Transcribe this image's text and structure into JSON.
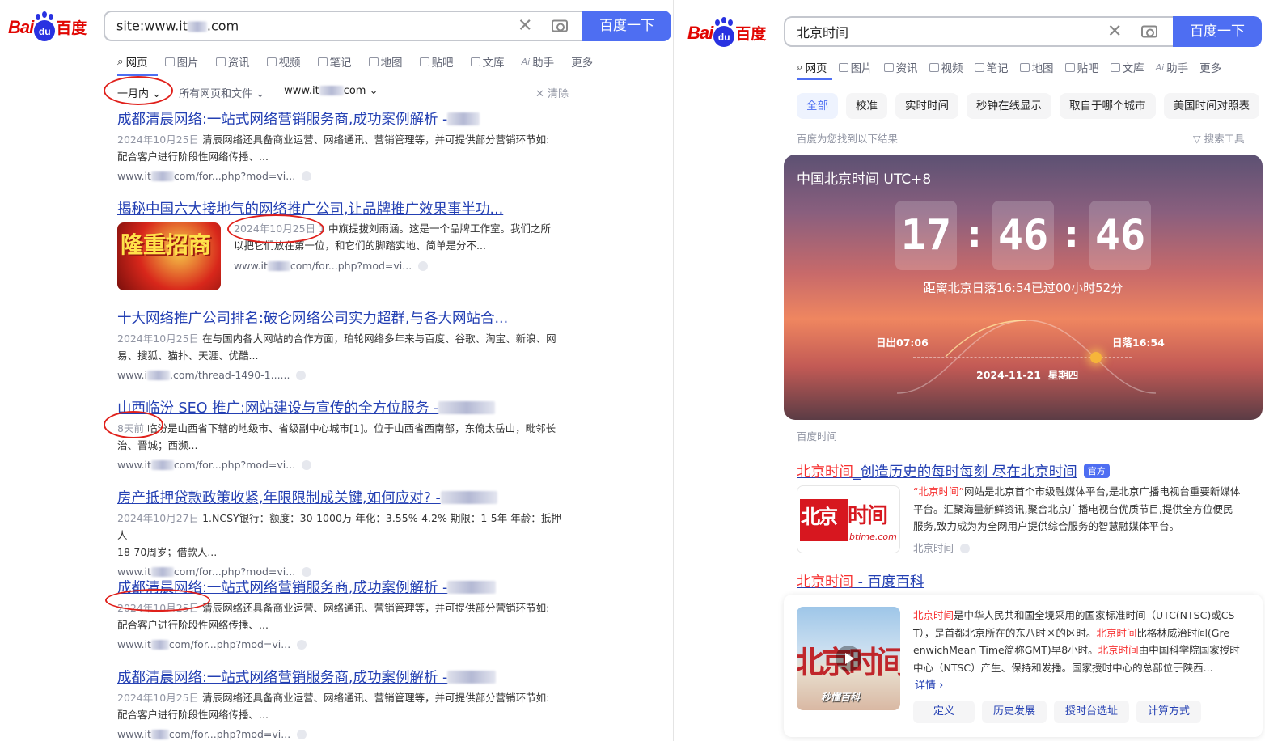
{
  "left": {
    "logo": {
      "bai": "Bai",
      "du": "du",
      "cn": "百度"
    },
    "search": {
      "query_pre": "site:www.it",
      "query_post": ".com",
      "button": "百度一下"
    },
    "tabs": [
      "网页",
      "图片",
      "资讯",
      "视频",
      "笔记",
      "地图",
      "贴吧",
      "文库",
      "助手",
      "更多"
    ],
    "filters": {
      "time": "一月内",
      "type": "所有网页和文件",
      "site_pre": "www.it",
      "site_post": "com",
      "clear": "清除"
    },
    "results": [
      {
        "title": "成都清晨网络:一站式网络营销服务商,成功案例解析 -",
        "date": "2024年10月25日",
        "desc": "清辰网络还具备商业运营、网络通讯、营销管理等，并可提供部分营销环节如:",
        "desc2": "配合客户进行阶段性网络传播、...",
        "url_pre": "www.it",
        "url_post": "com/for...php?mod=vi..."
      },
      {
        "title": "揭秘中国六大接地气的网络推广公司,让品牌推广效果事半功...",
        "date": "2024年10月25日 1",
        "desc": "中旗提拔刘雨涵。这是一个品牌工作室。我们之所",
        "desc2": "以把它们放在第一位，和它们的脚踏实地、简单是分不...",
        "url_pre": "www.it",
        "url_post": "com/for...php?mod=vi...",
        "thumb": "隆重招商"
      },
      {
        "title": "十大网络推广公司排名:破仑网络公司实力超群,与各大网站合...",
        "date": "2024年10月25日",
        "desc": "在与国内各大网站的合作方面，珀轮网络多年来与百度、谷歌、淘宝、新浪、网",
        "desc2": "易、搜狐、猫扑、天涯、优酷...",
        "url_pre": "www.i",
        "url_post": ".com/thread-1490-1......"
      },
      {
        "title": "山西临汾 SEO 推广:网站建设与宣传的全方位服务 -",
        "date": "8天前",
        "desc": "临汾是山西省下辖的地级市、省级副中心城市[1]。位于山西省西南部，东倚太岳山，毗邻长",
        "desc2": "治、晋城；西濒...",
        "url_pre": "www.it",
        "url_post": "com/for...php?mod=vi..."
      },
      {
        "title": "房产抵押贷款政策收紧,年限限制成关键,如何应对? -",
        "date": "2024年10月27日",
        "desc": "1.NCSY银行：额度：30-1000万 年化：3.55%-4.2% 期限：1-5年 年龄：抵押人",
        "desc2": "18-70周岁；借款人...",
        "url_pre": "www.it",
        "url_post": "com/for...php?mod=vi..."
      },
      {
        "title": "成都清晨网络:一站式网络营销服务商,成功案例解析 -",
        "date": "2024年10月25日",
        "desc": "清辰网络还具备商业运营、网络通讯、营销管理等，并可提供部分营销环节如:",
        "desc2": "配合客户进行阶段性网络传播、...",
        "url_pre": "www.it",
        "url_post": "com/for...php?mod=vi..."
      },
      {
        "title": "成都清晨网络:一站式网络营销服务商,成功案例解析 -",
        "date": "2024年10月25日",
        "desc": "清辰网络还具备商业运营、网络通讯、营销管理等，并可提供部分营销环节如:",
        "desc2": "配合客户进行阶段性网络传播、...",
        "url_pre": "www.it",
        "url_post": "com/for...php?mod=vi..."
      }
    ]
  },
  "right": {
    "logo": {
      "bai": "Bai",
      "du": "du",
      "cn": "百度"
    },
    "search": {
      "query": "北京时间",
      "button": "百度一下"
    },
    "tabs": [
      "网页",
      "图片",
      "资讯",
      "视频",
      "笔记",
      "地图",
      "贴吧",
      "文库",
      "助手",
      "更多"
    ],
    "chips": [
      "全部",
      "校准",
      "实时时间",
      "秒钟在线显示",
      "取自于哪个城市",
      "美国时间对照表"
    ],
    "found": "百度为您找到以下结果",
    "tools": "搜索工具",
    "clock": {
      "title": "中国北京时间 UTC+8",
      "hh": "17",
      "mm": "46",
      "ss": "46",
      "since": "距离北京日落16:54已过00小时52分",
      "sunrise": "日出07:06",
      "sunset": "日落16:54",
      "date": "2024-11-21",
      "weekday": "星期四"
    },
    "clock_source": "百度时间",
    "result1": {
      "title_hl": "北京时间",
      "title_rest": "_创造历史的每时每刻 尽在北京时间",
      "badge": "官方",
      "desc_hl": "“北京时间”",
      "desc": "网站是北京首个市级融媒体平台,是北京广播电视台重要新媒体",
      "desc2": "平台。汇聚海量新鲜资讯,聚合北京广播电视台优质节目,提供全方位便民",
      "desc3": "服务,致力成为为全网用户提供综合服务的智慧融媒体平台。",
      "source": "北京时间",
      "logo_a": "北京",
      "logo_b": "时间",
      "logo_c": "btime.com"
    },
    "result2": {
      "title_hl": "北京时间",
      "title_rest": " - 百度百科",
      "l1_hl": "北京时间",
      "l1": "是中华人民共和国全境采用的国家标准时间（UTC(NTSC)或CS",
      "l2a": "T），是首都北京所在的东八时区的区时。",
      "l2_hl": "北京时间",
      "l2b": "比格林威治时间(Gre",
      "l3a": "enwichMean Time简称GMT)早8小时。",
      "l3_hl": "北京时间",
      "l3b": "由中国科学院国家授时",
      "l4": "中心（NTSC）产生、保持和发播。国家授时中心的总部位于陕西...",
      "more": "详情 ›",
      "video_text": "北京时间",
      "video_brand": "秒懂百科",
      "pills": [
        "定义",
        "历史发展",
        "授时台选址",
        "计算方式"
      ]
    }
  }
}
